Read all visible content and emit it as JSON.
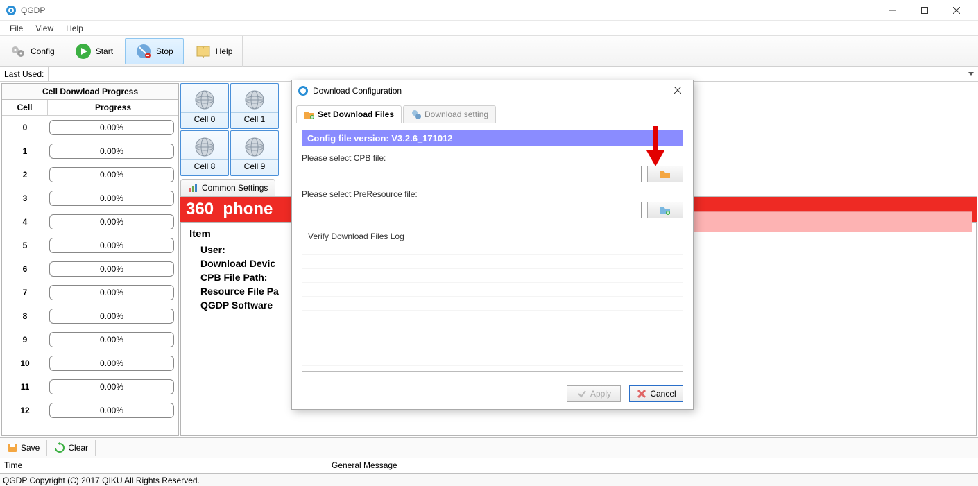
{
  "window": {
    "title": "QGDP"
  },
  "menu": {
    "file": "File",
    "view": "View",
    "help": "Help"
  },
  "toolbar": {
    "config": "Config",
    "start": "Start",
    "stop": "Stop",
    "help": "Help"
  },
  "lastused": {
    "label": "Last Used:"
  },
  "leftpanel": {
    "title": "Cell Donwload Progress",
    "col_cell": "Cell",
    "col_progress": "Progress",
    "rows": [
      {
        "cell": "0",
        "pct": "0.00%"
      },
      {
        "cell": "1",
        "pct": "0.00%"
      },
      {
        "cell": "2",
        "pct": "0.00%"
      },
      {
        "cell": "3",
        "pct": "0.00%"
      },
      {
        "cell": "4",
        "pct": "0.00%"
      },
      {
        "cell": "5",
        "pct": "0.00%"
      },
      {
        "cell": "6",
        "pct": "0.00%"
      },
      {
        "cell": "7",
        "pct": "0.00%"
      },
      {
        "cell": "8",
        "pct": "0.00%"
      },
      {
        "cell": "9",
        "pct": "0.00%"
      },
      {
        "cell": "10",
        "pct": "0.00%"
      },
      {
        "cell": "11",
        "pct": "0.00%"
      },
      {
        "cell": "12",
        "pct": "0.00%"
      }
    ]
  },
  "cells": {
    "row1": [
      "Cell 0",
      "Cell 1"
    ],
    "row2": [
      "Cell 8",
      "Cell 9"
    ]
  },
  "tabs": {
    "common": "Common Settings"
  },
  "banner": "360_phone",
  "info": {
    "header": "Item",
    "user": "User:",
    "device": "Download Devic",
    "cpb": "CPB File Path:",
    "resource": "Resource File Pa",
    "software": "QGDP Software"
  },
  "bottom": {
    "save": "Save",
    "clear": "Clear"
  },
  "grid": {
    "time": "Time",
    "msg": "General Message"
  },
  "status": "QGDP Copyright (C) 2017 QIKU All Rights Reserved.",
  "dialog": {
    "title": "Download Configuration",
    "tab1": "Set Download Files",
    "tab2": "Download setting",
    "version": "Config file version: V3.2.6_171012",
    "cpb_label": "Please select CPB file:",
    "pre_label": "Please select PreResource file:",
    "log_label": "Verify Download Files Log",
    "apply": "Apply",
    "cancel": "Cancel"
  }
}
